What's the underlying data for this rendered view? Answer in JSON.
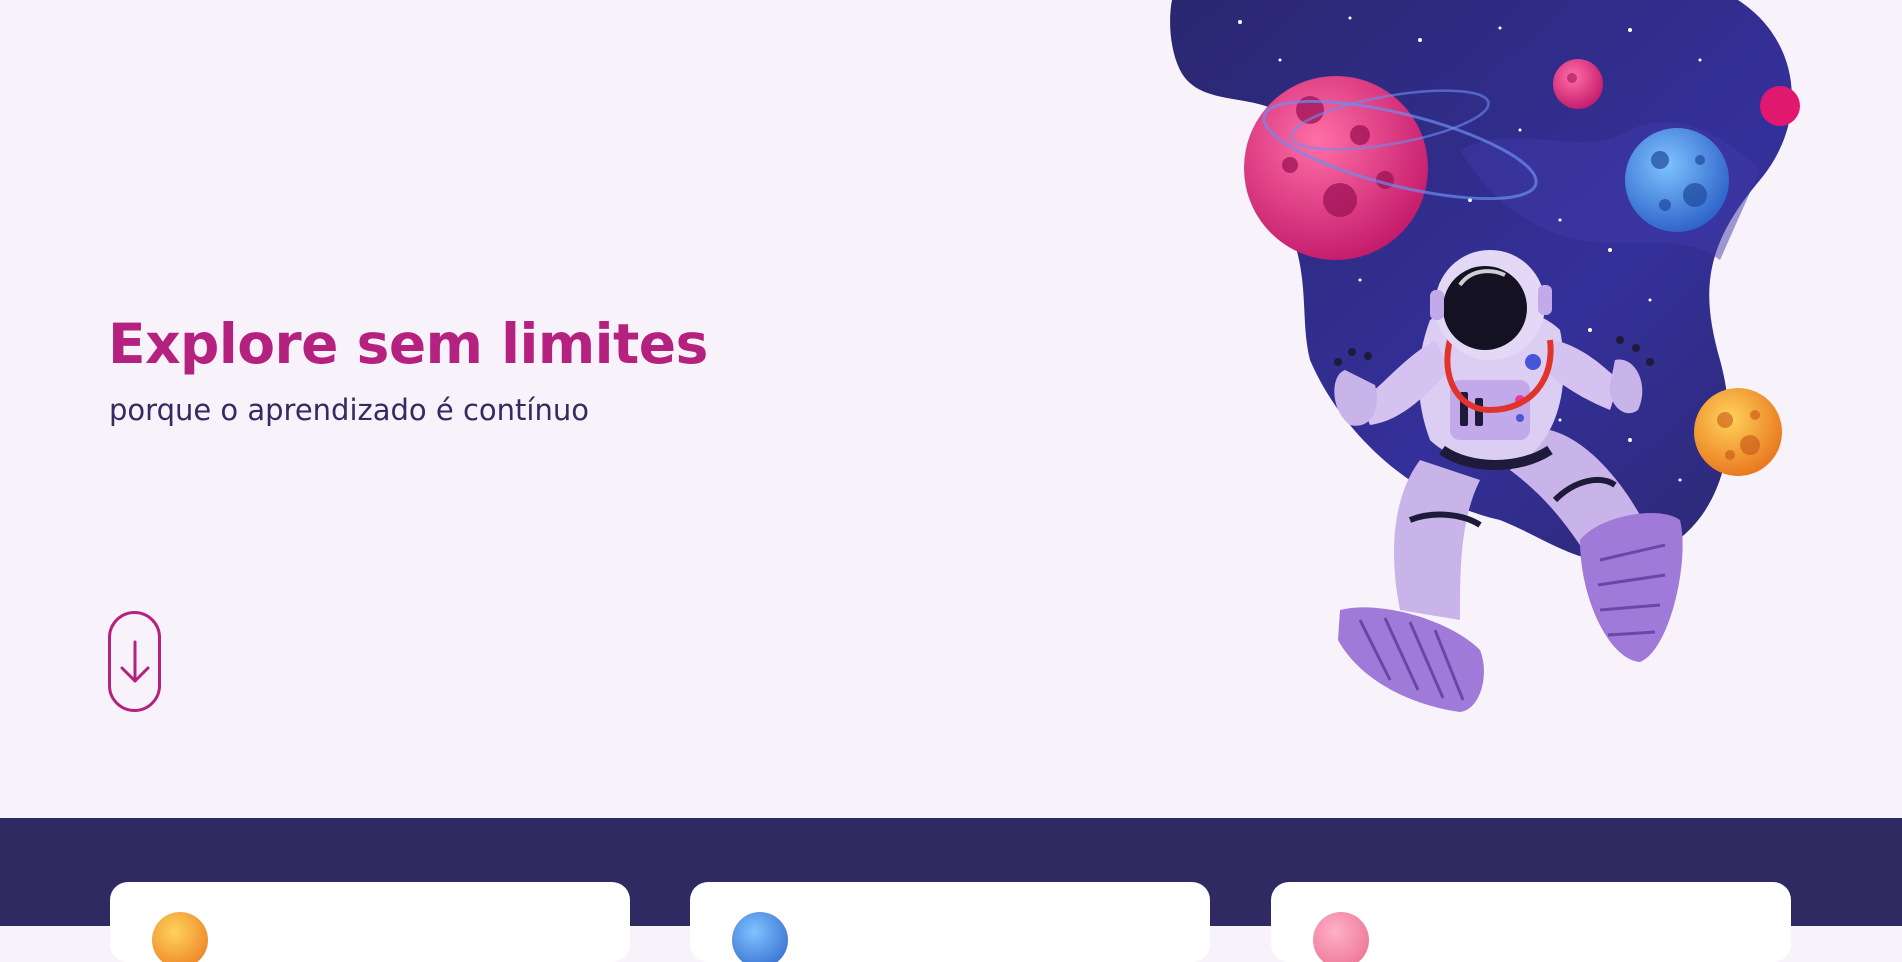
{
  "hero": {
    "title": "Explore sem limites",
    "subtitle": "porque o aprendizado é contínuo",
    "scroll_button_icon": "arrow-down-icon",
    "illustration": "astronaut-floating-in-space-with-planets"
  },
  "colors": {
    "background": "#f8f2fa",
    "accent": "#b5217f",
    "text_dark": "#342b61",
    "section_dark": "#302a62",
    "card": "#ffffff"
  },
  "cards": [
    {
      "icon": "orange-planet-icon"
    },
    {
      "icon": "blue-planet-icon"
    },
    {
      "icon": "pink-planet-icon"
    }
  ]
}
